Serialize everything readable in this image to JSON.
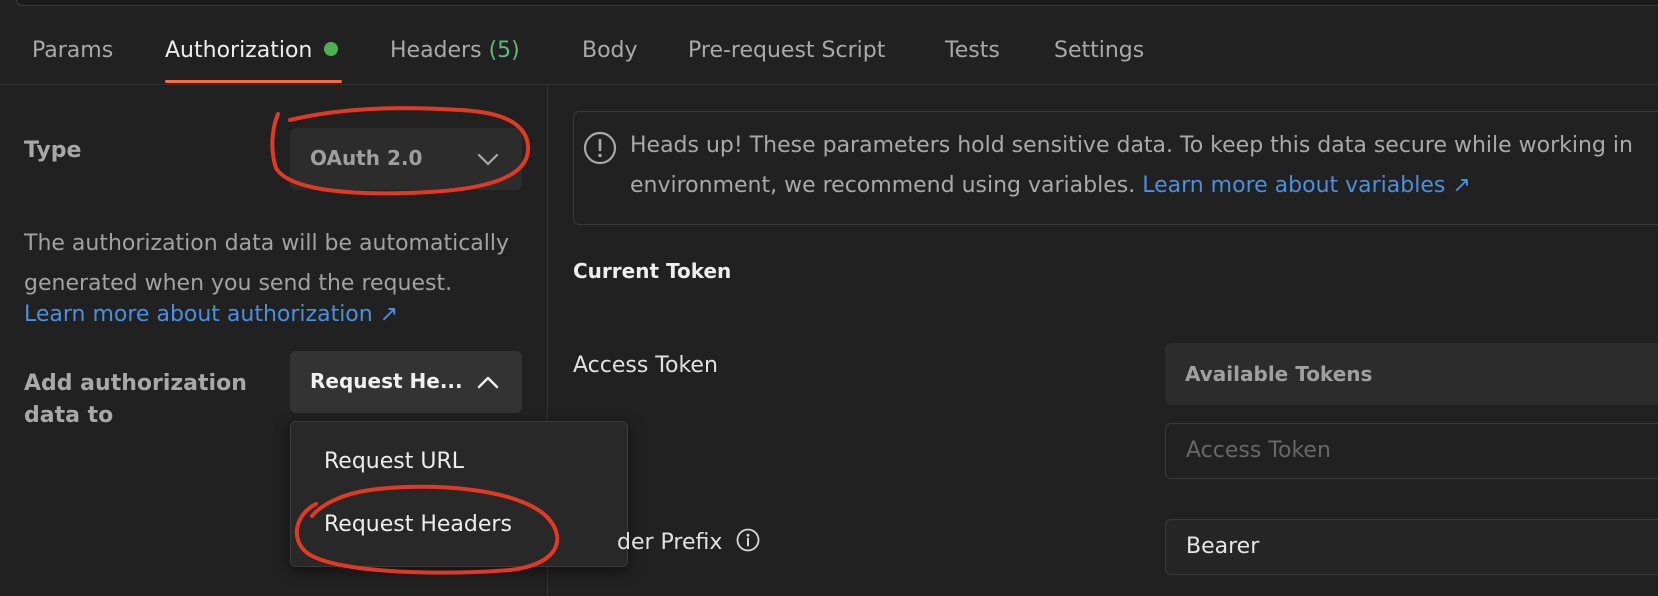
{
  "tabs": [
    {
      "label": "Params"
    },
    {
      "label": "Authorization"
    },
    {
      "label": "Headers",
      "count": "(5)"
    },
    {
      "label": "Body"
    },
    {
      "label": "Pre-request Script"
    },
    {
      "label": "Tests"
    },
    {
      "label": "Settings"
    }
  ],
  "auth": {
    "type_label": "Type",
    "type_value": "OAuth 2.0",
    "description": "The authorization data will be automatically generated when you send the request.",
    "learn_link": "Learn more about authorization ↗",
    "add_to_label": "Add authorization data to",
    "add_to_value": "Request He...",
    "add_to_options": [
      "Request URL",
      "Request Headers"
    ]
  },
  "warning": {
    "text_line1": "Heads up! These parameters hold sensitive data. To keep this data secure while working in",
    "text_line2": "environment, we recommend using variables.",
    "link": "Learn more about variables ↗"
  },
  "token": {
    "section_title": "Current Token",
    "access_token_label": "Access Token",
    "available_tokens_label": "Available Tokens",
    "access_token_placeholder": "Access Token",
    "header_prefix_label": "der Prefix",
    "header_prefix_value": "Bearer"
  },
  "colors": {
    "accent": "#ff6c37",
    "status_dot": "#4caf50",
    "link": "#4a8fe0",
    "annotation": "#e03a25"
  }
}
